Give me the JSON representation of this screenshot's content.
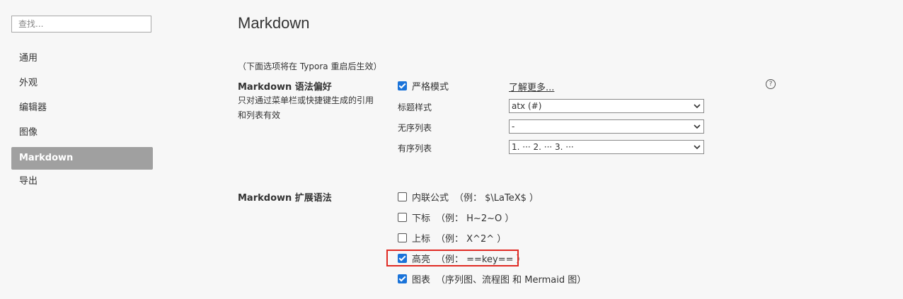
{
  "search": {
    "placeholder": "查找..."
  },
  "sidebar": {
    "items": [
      {
        "label": "通用"
      },
      {
        "label": "外观"
      },
      {
        "label": "编辑器"
      },
      {
        "label": "图像"
      },
      {
        "label": "Markdown",
        "active": true
      },
      {
        "label": "导出"
      }
    ]
  },
  "main": {
    "title": "Markdown",
    "restart_note": "（下面选项将在 Typora 重启后生效）",
    "syntax_pref": {
      "label": "Markdown 语法偏好",
      "desc": "只对通过菜单栏或快捷键生成的引用和列表有效",
      "strict_mode": {
        "label": "严格模式",
        "checked": true
      },
      "learn_more": "了解更多...",
      "heading_style": {
        "label": "标题样式",
        "value": "atx (#)"
      },
      "unordered_list": {
        "label": "无序列表",
        "value": "-"
      },
      "ordered_list": {
        "label": "有序列表",
        "value": "1. ··· 2. ··· 3. ···"
      }
    },
    "ext_syntax": {
      "label": "Markdown 扩展语法",
      "items": [
        {
          "label": "内联公式",
          "hint": "（例： $\\LaTeX$ ）",
          "checked": false
        },
        {
          "label": "下标",
          "hint": "（例： H~2~O ）",
          "checked": false
        },
        {
          "label": "上标",
          "hint": "（例： X^2^ ）",
          "checked": false
        },
        {
          "label": "高亮",
          "hint": "（例： ==key== ）",
          "checked": true
        },
        {
          "label": "图表",
          "hint": "（序列图、流程图 和 Mermaid 图）",
          "checked": true
        }
      ]
    }
  },
  "colors": {
    "accent": "#1a73d9",
    "highlight_border": "#e02b24",
    "active_nav": "#a0a0a0"
  }
}
